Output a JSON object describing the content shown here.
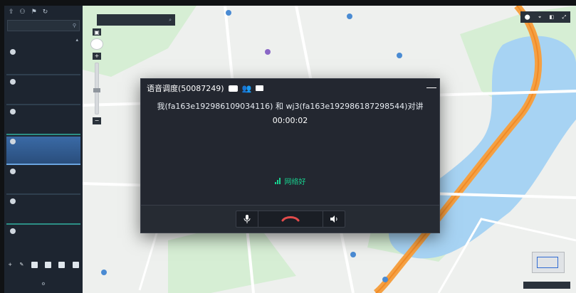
{
  "dialog": {
    "title": "语音调度(50087249)",
    "participants_text": "我(fa163e192986109034116) 和 wj3(fa163e192986187298544)对讲",
    "timer": "00:00:02",
    "network_status": "网络好",
    "icons": {
      "video": "video-camera-icon",
      "group": "group-icon",
      "chat": "chat-bubble-icon",
      "mic": "microphone-icon",
      "hangup": "hang-up-phone-icon",
      "speaker": "speaker-icon"
    },
    "colors": {
      "wave_start": "#2f7bd3",
      "wave_end": "#2bd5a2",
      "network": "#18d18f",
      "hangup": "#e24b4b"
    }
  }
}
